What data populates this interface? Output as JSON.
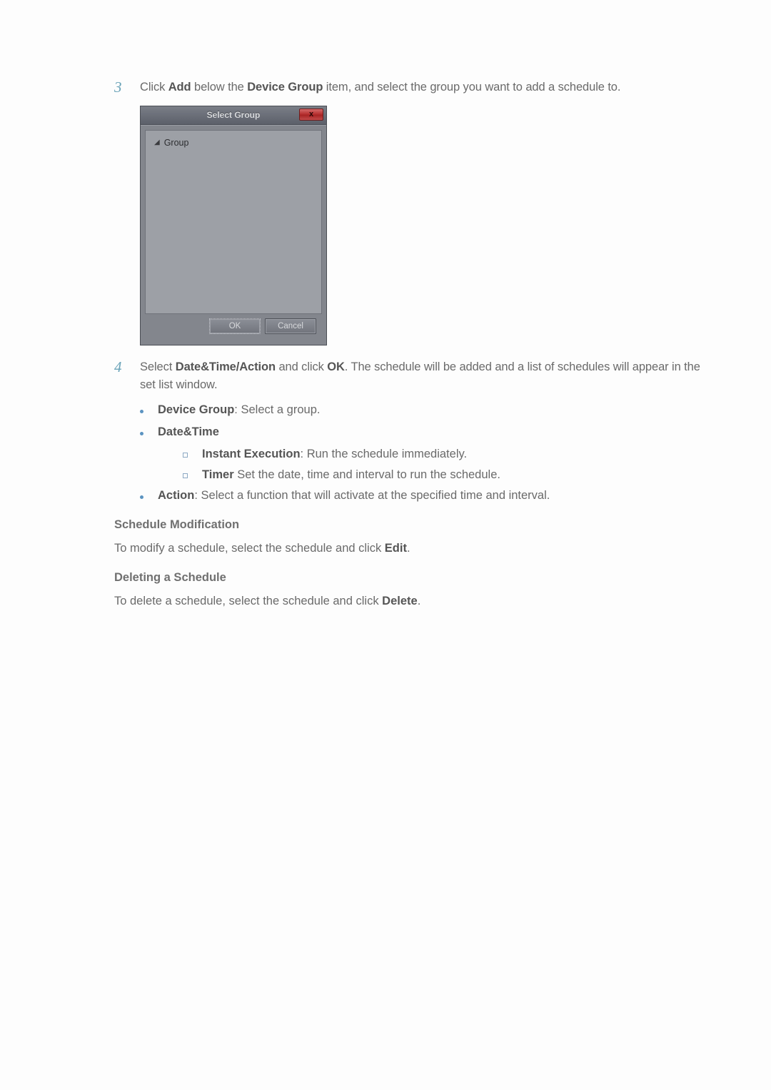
{
  "step3": {
    "num": "3",
    "text_before": "Click ",
    "add": "Add",
    "text_mid1": " below the ",
    "device_group": "Device Group",
    "text_after": " item, and select the group you want to add a schedule to."
  },
  "dialog": {
    "title": "Select Group",
    "close": "x",
    "tree_item": "Group",
    "ok": "OK",
    "cancel": "Cancel"
  },
  "step4": {
    "num": "4",
    "s1": "Select ",
    "dta": "Date&Time/Action",
    "s2": " and click ",
    "ok": "OK",
    "s3": ". The schedule will be added and a list of schedules will appear in the set list window."
  },
  "bullets": {
    "dg_label": "Device Group",
    "dg_rest": ": Select a group.",
    "dt_label": "Date&Time",
    "ie_label": "Instant Execution",
    "ie_rest": ": Run the schedule immediately.",
    "timer_label": "Timer",
    "timer_rest": " Set the date, time and interval to run the schedule.",
    "action_label": "Action",
    "action_rest": ": Select a function that will activate at the specified time and interval."
  },
  "mod": {
    "heading": "Schedule Modification",
    "p1a": "To modify a schedule, select the schedule and click ",
    "p1b": "Edit",
    "p1c": "."
  },
  "del": {
    "heading": "Deleting a Schedule",
    "p1a": "To delete a schedule, select the schedule and click ",
    "p1b": "Delete",
    "p1c": "."
  }
}
